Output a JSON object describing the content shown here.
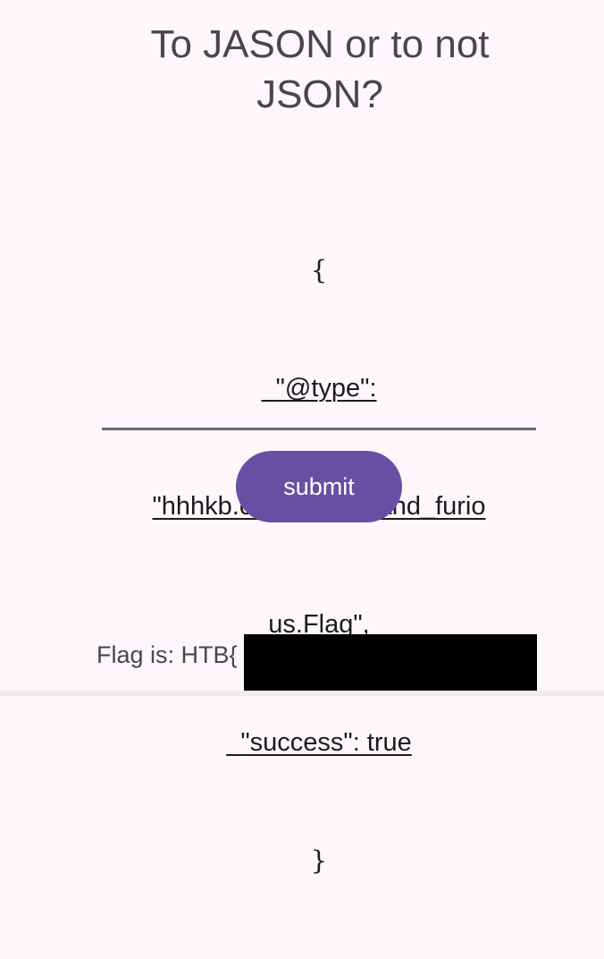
{
  "app": {
    "title": "To JASON or to not JSON?"
  },
  "json_input": {
    "value_lines": [
      "{",
      "  \"@type\":",
      "\"hhhkb.ctf.fastjson_and_furio",
      "us.Flag\",",
      "  \"success\": true",
      "}"
    ]
  },
  "submit": {
    "label": "submit"
  },
  "result": {
    "flag_text": "Flag is: HTB{"
  },
  "colors": {
    "background": "#fdf7fc",
    "primary": "#6750a4",
    "text": "#47464f",
    "input_text": "#1c1b1f"
  }
}
